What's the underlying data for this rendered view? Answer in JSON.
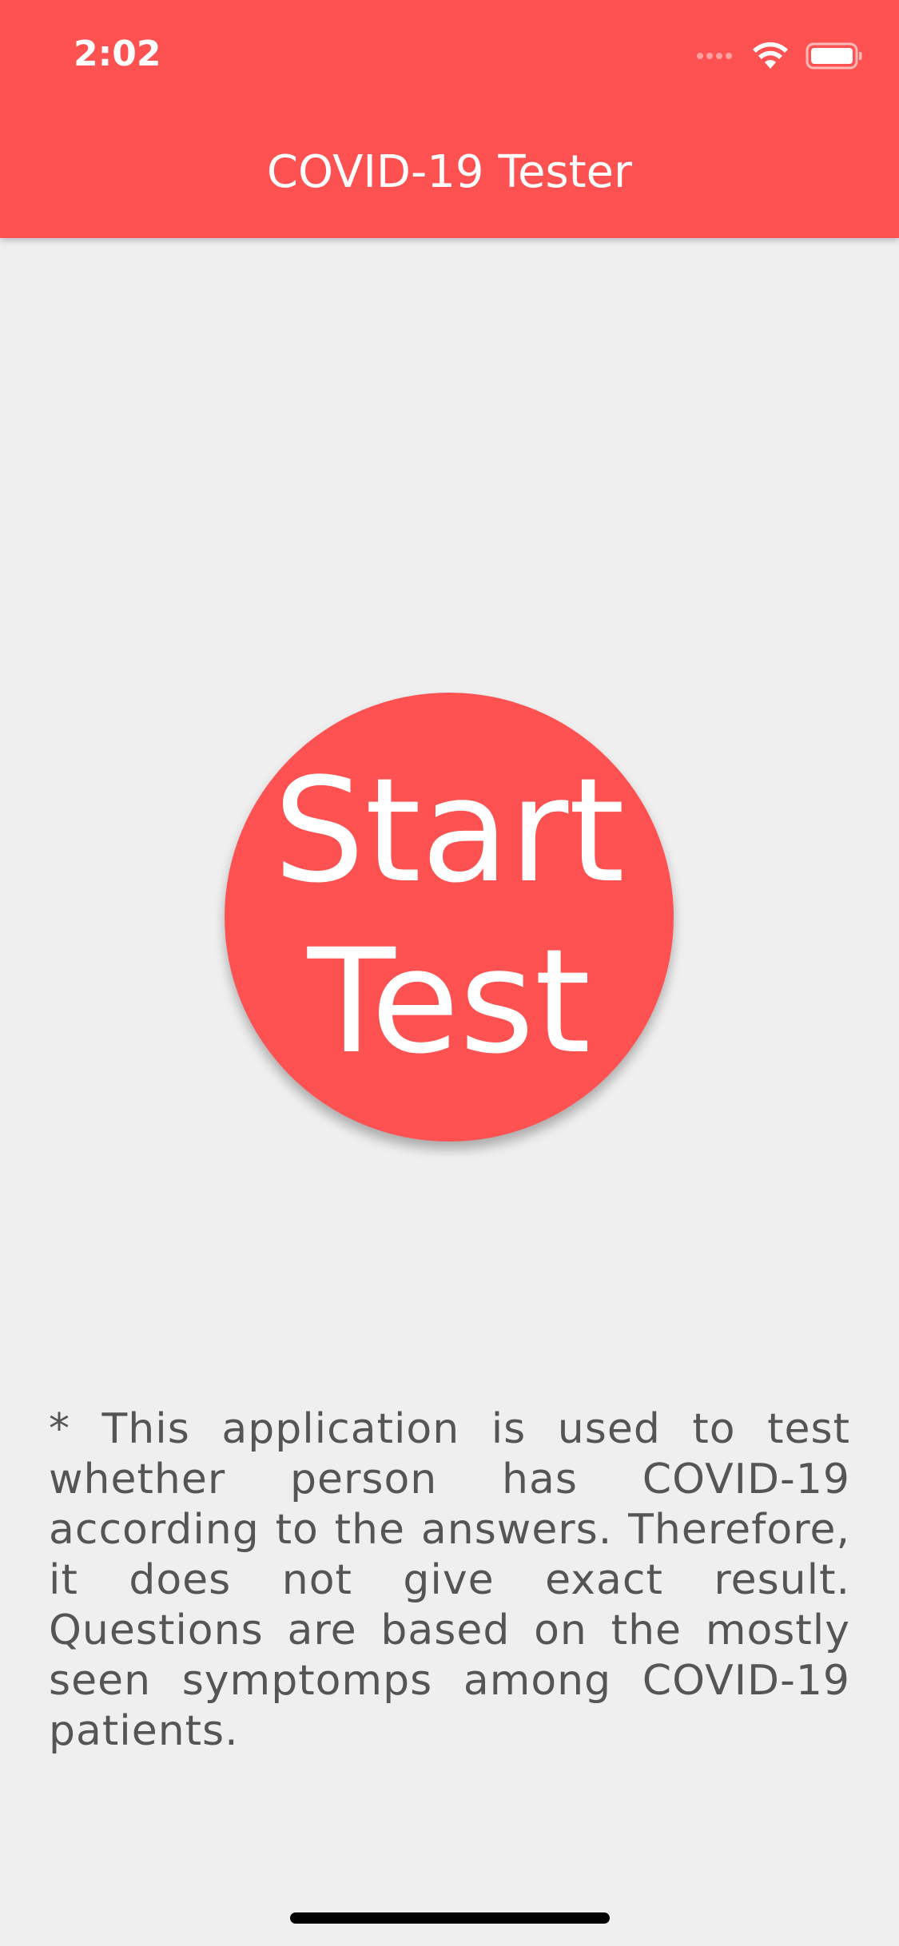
{
  "status_bar": {
    "time": "2:02"
  },
  "header": {
    "title": "COVID-19 Tester",
    "background_color": "#fe5252"
  },
  "start_button": {
    "line1": "Start",
    "line2": "Test",
    "background_color": "#fe5252"
  },
  "disclaimer": {
    "text": "* This application is used to test whether person has COVID-19 according to the answers. Therefore, it does not give exact result. Questions are based on the mostly seen symptomps among COVID-19 patients."
  },
  "icons": {
    "signal": "cellular-signal-icon",
    "wifi": "wifi-icon",
    "battery": "battery-icon"
  }
}
